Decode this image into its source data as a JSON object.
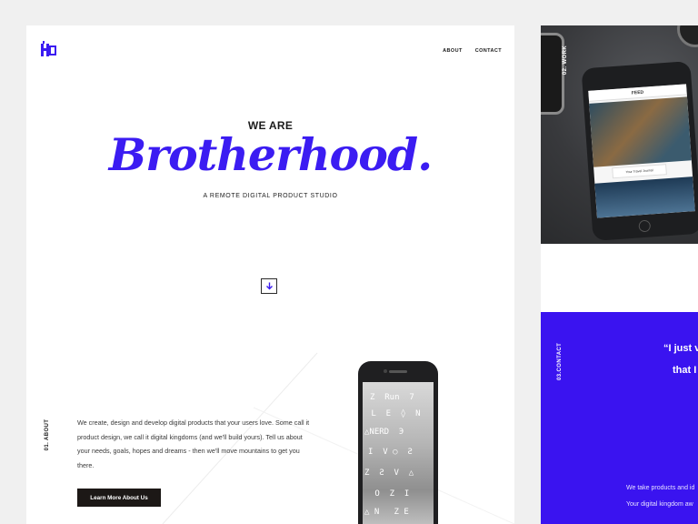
{
  "nav": {
    "about": "ABOUT",
    "contact": "CONTACT"
  },
  "hero": {
    "pre": "WE ARE",
    "title": "Brotherhood.",
    "subtitle": "A REMOTE DIGITAL PRODUCT STUDIO"
  },
  "about": {
    "label": "01. ABOUT",
    "text": "We create, design and develop digital products that your users love. Some call it product design, we call it digital kingdoms (and we'll build yours). Tell us about your needs, goals, hopes and dreams - then we'll move mountains to get you there.",
    "button": "Learn More About Us"
  },
  "work": {
    "label": "02. WORK"
  },
  "contact": {
    "label": "03.CONTACT",
    "quote_line1": "“I just v",
    "quote_line2": "that I",
    "text_line1": "We take products and id",
    "text_line2": "Your digital kingdom aw"
  },
  "colors": {
    "accent": "#3b1cf2",
    "contact_bg": "#3a13f0",
    "button_bg": "#1c1816"
  }
}
